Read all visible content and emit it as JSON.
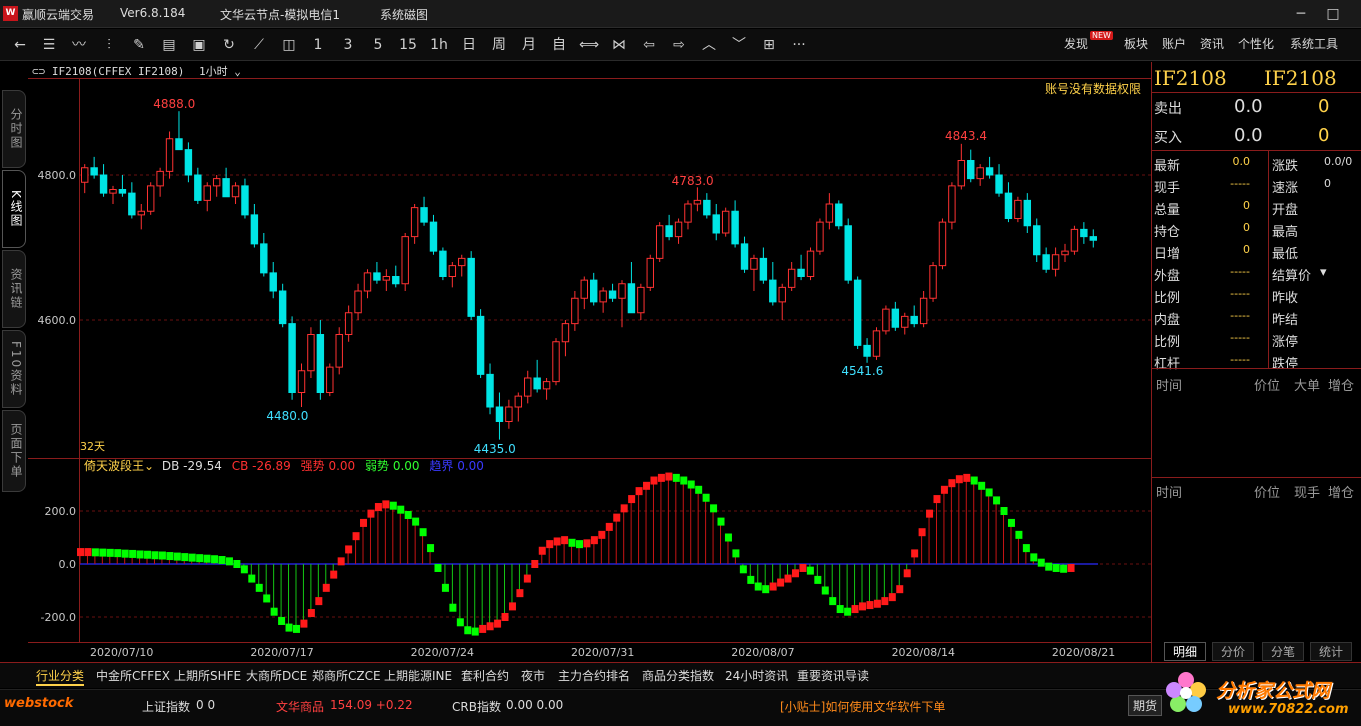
{
  "window": {
    "app_name": "赢顺云端交易",
    "version": "Ver6.8.184",
    "server": "文华云节点-模拟电信1",
    "menu": "系统磁图",
    "min": "─",
    "max": "□",
    "close": "✕"
  },
  "toolbar": {
    "periods": [
      "1",
      "3",
      "5",
      "15",
      "1h",
      "日",
      "周",
      "月",
      "自"
    ],
    "more": "···",
    "right": [
      "发现",
      "板块",
      "账户",
      "资讯",
      "个性化",
      "系统工具"
    ],
    "new_badge": "NEW"
  },
  "left_tabs": [
    "分时图",
    "K线图",
    "资讯链",
    "F10资料",
    "页面下单"
  ],
  "chart": {
    "symbol": "IF2108(CFFEX IF2108)",
    "period": "1小时",
    "notice": "账号没有数据权限",
    "days": "32天",
    "price_ticks": [
      "4800.0",
      "4600.0"
    ],
    "markers": {
      "high1": "4888.0",
      "low1": "4480.0",
      "low2": "4435.0",
      "high2": "4783.0",
      "high3": "4843.4",
      "low3": "4541.6"
    },
    "dates": [
      "2020/07/10",
      "2020/07/17",
      "2020/07/24",
      "2020/07/31",
      "2020/08/07",
      "2020/08/14",
      "2020/08/21"
    ]
  },
  "indicator": {
    "name": "倚天波段王",
    "db": "DB -29.54",
    "cb": "CB -26.89",
    "strong": "强势 0.00",
    "weak": "弱势 0.00",
    "bound": "趋界 0.00",
    "ticks": [
      "200.0",
      "0.0",
      "-200.0"
    ]
  },
  "chart_data": {
    "type": "candlestick",
    "candles": [
      [
        4790,
        4815,
        4775,
        4810
      ],
      [
        4810,
        4825,
        4795,
        4800
      ],
      [
        4800,
        4815,
        4770,
        4775
      ],
      [
        4775,
        4785,
        4760,
        4780
      ],
      [
        4780,
        4800,
        4770,
        4775
      ],
      [
        4775,
        4790,
        4740,
        4745
      ],
      [
        4745,
        4760,
        4725,
        4750
      ],
      [
        4750,
        4790,
        4745,
        4785
      ],
      [
        4785,
        4810,
        4770,
        4805
      ],
      [
        4805,
        4860,
        4795,
        4850
      ],
      [
        4850,
        4888,
        4840,
        4835
      ],
      [
        4835,
        4845,
        4790,
        4800
      ],
      [
        4800,
        4810,
        4760,
        4765
      ],
      [
        4765,
        4790,
        4750,
        4785
      ],
      [
        4785,
        4800,
        4770,
        4795
      ],
      [
        4795,
        4810,
        4780,
        4770
      ],
      [
        4770,
        4790,
        4760,
        4785
      ],
      [
        4785,
        4795,
        4740,
        4745
      ],
      [
        4745,
        4760,
        4700,
        4705
      ],
      [
        4705,
        4720,
        4660,
        4665
      ],
      [
        4665,
        4680,
        4630,
        4640
      ],
      [
        4640,
        4650,
        4590,
        4595
      ],
      [
        4595,
        4605,
        4490,
        4500
      ],
      [
        4500,
        4540,
        4480,
        4530
      ],
      [
        4530,
        4590,
        4520,
        4580
      ],
      [
        4580,
        4600,
        4490,
        4500
      ],
      [
        4500,
        4540,
        4495,
        4535
      ],
      [
        4535,
        4590,
        4525,
        4580
      ],
      [
        4580,
        4620,
        4570,
        4610
      ],
      [
        4610,
        4650,
        4600,
        4640
      ],
      [
        4640,
        4670,
        4630,
        4665
      ],
      [
        4665,
        4680,
        4650,
        4655
      ],
      [
        4655,
        4670,
        4640,
        4660
      ],
      [
        4660,
        4675,
        4645,
        4650
      ],
      [
        4650,
        4720,
        4640,
        4715
      ],
      [
        4715,
        4760,
        4705,
        4755
      ],
      [
        4755,
        4770,
        4730,
        4735
      ],
      [
        4735,
        4745,
        4690,
        4695
      ],
      [
        4695,
        4700,
        4655,
        4660
      ],
      [
        4660,
        4680,
        4645,
        4675
      ],
      [
        4675,
        4690,
        4660,
        4685
      ],
      [
        4685,
        4695,
        4600,
        4605
      ],
      [
        4605,
        4615,
        4520,
        4525
      ],
      [
        4525,
        4540,
        4470,
        4480
      ],
      [
        4480,
        4500,
        4435,
        4460
      ],
      [
        4460,
        4490,
        4450,
        4480
      ],
      [
        4480,
        4500,
        4460,
        4495
      ],
      [
        4495,
        4530,
        4485,
        4520
      ],
      [
        4520,
        4545,
        4500,
        4505
      ],
      [
        4505,
        4520,
        4490,
        4515
      ],
      [
        4515,
        4575,
        4510,
        4570
      ],
      [
        4570,
        4600,
        4550,
        4595
      ],
      [
        4595,
        4640,
        4585,
        4630
      ],
      [
        4630,
        4660,
        4615,
        4655
      ],
      [
        4655,
        4665,
        4620,
        4625
      ],
      [
        4625,
        4645,
        4610,
        4640
      ],
      [
        4640,
        4650,
        4625,
        4630
      ],
      [
        4630,
        4655,
        4590,
        4650
      ],
      [
        4650,
        4680,
        4630,
        4610
      ],
      [
        4610,
        4650,
        4600,
        4645
      ],
      [
        4645,
        4690,
        4640,
        4685
      ],
      [
        4685,
        4735,
        4680,
        4730
      ],
      [
        4730,
        4745,
        4710,
        4715
      ],
      [
        4715,
        4740,
        4705,
        4735
      ],
      [
        4735,
        4765,
        4725,
        4760
      ],
      [
        4760,
        4783,
        4750,
        4765
      ],
      [
        4765,
        4775,
        4740,
        4745
      ],
      [
        4745,
        4760,
        4710,
        4720
      ],
      [
        4720,
        4755,
        4715,
        4750
      ],
      [
        4750,
        4765,
        4700,
        4705
      ],
      [
        4705,
        4715,
        4665,
        4670
      ],
      [
        4670,
        4690,
        4640,
        4685
      ],
      [
        4685,
        4700,
        4650,
        4655
      ],
      [
        4655,
        4680,
        4620,
        4625
      ],
      [
        4625,
        4650,
        4600,
        4645
      ],
      [
        4645,
        4680,
        4640,
        4670
      ],
      [
        4670,
        4690,
        4655,
        4660
      ],
      [
        4660,
        4700,
        4655,
        4695
      ],
      [
        4695,
        4740,
        4690,
        4735
      ],
      [
        4735,
        4775,
        4725,
        4760
      ],
      [
        4760,
        4765,
        4725,
        4730
      ],
      [
        4730,
        4740,
        4650,
        4655
      ],
      [
        4655,
        4660,
        4560,
        4565
      ],
      [
        4565,
        4575,
        4541,
        4550
      ],
      [
        4550,
        4590,
        4545,
        4585
      ],
      [
        4585,
        4620,
        4580,
        4615
      ],
      [
        4615,
        4625,
        4585,
        4590
      ],
      [
        4590,
        4610,
        4580,
        4605
      ],
      [
        4605,
        4620,
        4590,
        4595
      ],
      [
        4595,
        4640,
        4590,
        4630
      ],
      [
        4630,
        4680,
        4625,
        4675
      ],
      [
        4675,
        4740,
        4670,
        4735
      ],
      [
        4735,
        4790,
        4725,
        4785
      ],
      [
        4785,
        4843,
        4780,
        4820
      ],
      [
        4820,
        4835,
        4790,
        4795
      ],
      [
        4795,
        4815,
        4785,
        4810
      ],
      [
        4810,
        4825,
        4795,
        4800
      ],
      [
        4800,
        4815,
        4770,
        4775
      ],
      [
        4775,
        4790,
        4735,
        4740
      ],
      [
        4740,
        4770,
        4735,
        4765
      ],
      [
        4765,
        4775,
        4720,
        4730
      ],
      [
        4730,
        4740,
        4680,
        4690
      ],
      [
        4690,
        4700,
        4665,
        4670
      ],
      [
        4670,
        4700,
        4660,
        4690
      ],
      [
        4690,
        4705,
        4680,
        4695
      ],
      [
        4695,
        4730,
        4690,
        4725
      ],
      [
        4725,
        4735,
        4705,
        4715
      ],
      [
        4715,
        4725,
        4700,
        4710
      ]
    ],
    "indicator_values": [
      45,
      45,
      44,
      43,
      42,
      41,
      39,
      38,
      36,
      35,
      33,
      32,
      30,
      28,
      26,
      24,
      22,
      20,
      18,
      15,
      10,
      0,
      -20,
      -55,
      -90,
      -130,
      -180,
      -215,
      -240,
      -245,
      -225,
      -185,
      -140,
      -90,
      -40,
      10,
      55,
      105,
      155,
      190,
      215,
      225,
      220,
      205,
      185,
      160,
      120,
      60,
      -15,
      -90,
      -165,
      -220,
      -250,
      -255,
      -245,
      -235,
      -225,
      -200,
      -160,
      -110,
      -55,
      0,
      50,
      75,
      85,
      90,
      80,
      75,
      78,
      90,
      110,
      140,
      175,
      210,
      245,
      275,
      295,
      315,
      325,
      330,
      325,
      315,
      300,
      280,
      250,
      210,
      160,
      100,
      40,
      -20,
      -60,
      -85,
      -95,
      -85,
      -70,
      -55,
      -35,
      -15,
      -25,
      -60,
      -100,
      -140,
      -170,
      -180,
      -170,
      -160,
      -155,
      -150,
      -140,
      -125,
      -95,
      -35,
      40,
      120,
      190,
      245,
      280,
      305,
      320,
      325,
      315,
      295,
      270,
      240,
      200,
      155,
      110,
      60,
      25,
      5,
      -10,
      -15,
      -18,
      -15
    ]
  },
  "quote": {
    "name1": "IF2108",
    "name2": "IF2108",
    "sell": "卖出",
    "sell_p": "0.0",
    "sell_v": "0",
    "buy": "买入",
    "buy_p": "0.0",
    "buy_v": "0",
    "rows": [
      [
        "最新",
        "0.0",
        "涨跌",
        "0.0/0"
      ],
      [
        "现手",
        "-----",
        "速涨",
        "0"
      ],
      [
        "总量",
        "0",
        "开盘",
        ""
      ],
      [
        "持仓",
        "0",
        "最高",
        ""
      ],
      [
        "日增",
        "0",
        "最低",
        ""
      ],
      [
        "外盘",
        "-----",
        "结算价",
        ""
      ],
      [
        "比例",
        "-----",
        "昨收",
        ""
      ],
      [
        "内盘",
        "-----",
        "昨结",
        ""
      ],
      [
        "比例",
        "-----",
        "涨停",
        ""
      ],
      [
        "杠杆",
        "-----",
        "跌停",
        ""
      ]
    ],
    "tick_header": [
      "时间",
      "价位",
      "大单",
      "增仓"
    ],
    "detail_header": [
      "时间",
      "价位",
      "现手",
      "增仓"
    ],
    "tabs": [
      "明细",
      "分价",
      "分笔",
      "统计"
    ]
  },
  "bottom_tabs": [
    "行业分类",
    "中金所CFFEX",
    "上期所SHFE",
    "大商所DCE",
    "郑商所CZCE",
    "上期能源INE",
    "套利合约",
    "夜市",
    "主力合约排名",
    "商品分类指数",
    "24小时资讯",
    "重要资讯导读"
  ],
  "status": {
    "brand": "webstock",
    "shindex_label": "上证指数",
    "shindex_val": "0 0",
    "wh_label": "文华商品",
    "wh_val": "154.09 +0.22",
    "crb_label": "CRB指数",
    "crb_val": "0.00 0.00",
    "tip": "[小贴士]如何使用文华软件下单",
    "right": "期货",
    "watermark": "分析家公式网",
    "watermark_url": "www.70822.com"
  },
  "colors": {
    "up": "#ff3232",
    "down": "#00e5e5",
    "grid": "#7a1010",
    "accent": "#ffd700",
    "ind_up": "#ff1a1a",
    "ind_dn": "#00ff00"
  }
}
